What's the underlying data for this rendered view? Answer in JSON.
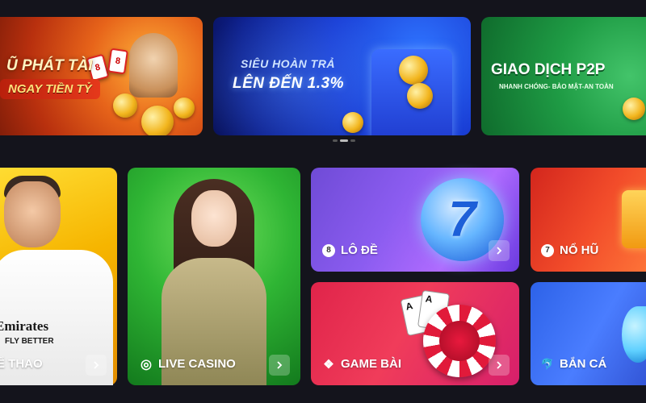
{
  "banners": [
    {
      "id": "jackpot",
      "line1": "Ũ PHÁT TÀI",
      "line2": "NGAY TIỀN TỶ",
      "card1": "8",
      "card2": "8"
    },
    {
      "id": "cashback",
      "line1": "SIÊU HOÀN TRẢ",
      "line2": "LÊN ĐẾN 1.3%"
    },
    {
      "id": "p2p",
      "line1": "GIAO DỊCH P2P",
      "line2": "NHANH CHÓNG- BẢO MẬT-AN TOÀN"
    }
  ],
  "carousel": {
    "slides": 3,
    "active": 1
  },
  "shirt": {
    "brand": "Emirates",
    "slogan": "FLY BETTER"
  },
  "orb_text": "7",
  "cards": {
    "a": "A",
    "b": "A"
  },
  "categories": [
    {
      "key": "sports",
      "label": "Ể THAO",
      "icon": "soccer-ball-icon",
      "has_arrow": true
    },
    {
      "key": "casino",
      "label": "LIVE CASINO",
      "icon": "casino-chip-icon",
      "icon_glyph": "◎",
      "has_arrow": true
    },
    {
      "key": "lode",
      "label": "LÔ ĐỀ",
      "icon": "lottery-ball-icon",
      "icon_glyph": "8",
      "has_arrow": true
    },
    {
      "key": "nohu",
      "label": "NỔ HŨ",
      "icon": "slot-seven-icon",
      "icon_glyph": "7",
      "has_arrow": false
    },
    {
      "key": "gamebai",
      "label": "GAME BÀI",
      "icon": "card-suits-icon",
      "icon_glyph": "❖",
      "has_arrow": true
    },
    {
      "key": "banca",
      "label": "BẮN CÁ",
      "icon": "fish-icon",
      "icon_glyph": "🐬",
      "has_arrow": false
    }
  ],
  "colors": {
    "page_bg": "#14141c",
    "sports": "#f6b500",
    "casino": "#2fb534",
    "lode": "#8b5cf0",
    "nohu": "#f24c2a",
    "gamebai": "#f03c5a",
    "banca": "#4a7dff"
  }
}
